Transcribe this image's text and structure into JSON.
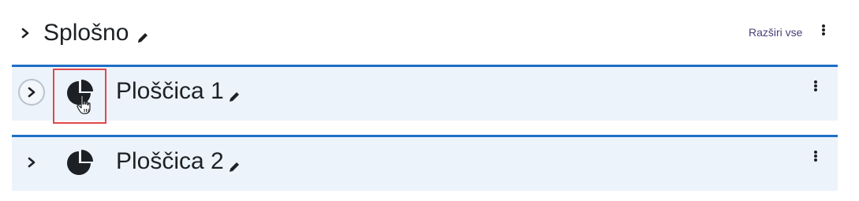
{
  "section": {
    "title": "Splošno",
    "expand_all_label": "Razširi vse"
  },
  "tiles": [
    {
      "title": "Ploščica 1",
      "expanded": false,
      "chevron_style": "circled",
      "highlighted": true
    },
    {
      "title": "Ploščica 2",
      "expanded": false,
      "chevron_style": "plain",
      "highlighted": false
    }
  ],
  "icons": {
    "collapse": "chevron-right-icon",
    "edit": "pencil-icon",
    "menu": "kebab-menu-icon",
    "tile": "pie-chart-icon",
    "pointer": "hand-pointer-icon"
  },
  "colors": {
    "accent": "#1f6fc7",
    "tile_background": "#edf3fb",
    "highlight": "#e0484b",
    "link": "#4a3f7a"
  }
}
